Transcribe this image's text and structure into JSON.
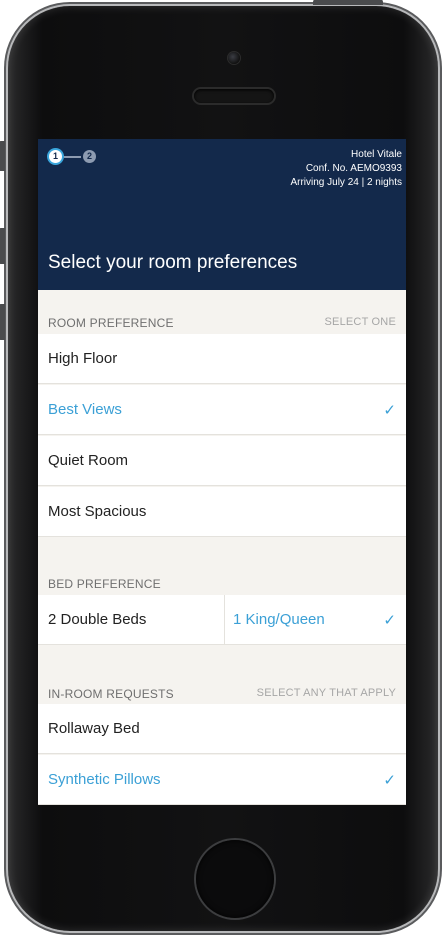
{
  "header": {
    "steps": [
      "1",
      "2"
    ],
    "hotel_name": "Hotel Vitale",
    "confirmation": "Conf. No. AEMO9393",
    "arrival": "Arriving July 24 | 2 nights",
    "title": "Select your room preferences"
  },
  "room_preference": {
    "title": "ROOM PREFERENCE",
    "hint": "SELECT ONE",
    "options": [
      {
        "label": "High Floor",
        "selected": false
      },
      {
        "label": "Best Views",
        "selected": true
      },
      {
        "label": "Quiet Room",
        "selected": false
      },
      {
        "label": "Most Spacious",
        "selected": false
      }
    ]
  },
  "bed_preference": {
    "title": "BED PREFERENCE",
    "options": [
      {
        "label": "2 Double Beds",
        "selected": false
      },
      {
        "label": "1 King/Queen",
        "selected": true
      }
    ]
  },
  "in_room_requests": {
    "title": "IN-ROOM REQUESTS",
    "hint": "SELECT ANY THAT APPLY",
    "options": [
      {
        "label": "Rollaway Bed",
        "selected": false
      },
      {
        "label": "Synthetic Pillows",
        "selected": true
      }
    ]
  },
  "check_glyph": "✓",
  "colors": {
    "header_bg": "#13294b",
    "accent": "#3ba0d6",
    "screen_bg": "#f5f3ef"
  }
}
